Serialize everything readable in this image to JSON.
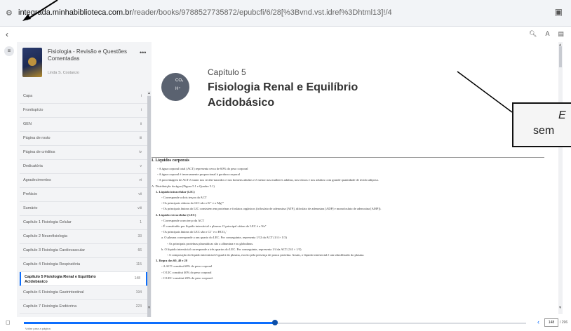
{
  "browser": {
    "url_host": "integrada.minhabiblioteca.com.br",
    "url_path": "/reader/books/9788527735872/epubcfi/6/28[%3Bvnd.vst.idref%3Dhtml13]!/4"
  },
  "book": {
    "title": "Fisiologia - Revisão e Questões Comentadas",
    "author": "Linda S. Costanzo"
  },
  "toc": [
    {
      "label": "Capa",
      "page": "i"
    },
    {
      "label": "Frontispício",
      "page": "i"
    },
    {
      "label": "GEN",
      "page": "ii"
    },
    {
      "label": "Página de rosto",
      "page": "iii"
    },
    {
      "label": "Página de créditos",
      "page": "iv"
    },
    {
      "label": "Dedicatória",
      "page": "v"
    },
    {
      "label": "Agradecimentos",
      "page": "vi"
    },
    {
      "label": "Prefácio",
      "page": "vii"
    },
    {
      "label": "Sumário",
      "page": "viii"
    },
    {
      "label": "Capítulo 1 Fisiologia Celular",
      "page": "1"
    },
    {
      "label": "Capítulo 2 Neurofisiologia",
      "page": "33"
    },
    {
      "label": "Capítulo 3 Fisiologia Cardiovascular",
      "page": "66"
    },
    {
      "label": "Capítulo 4 Fisiologia Respiratória",
      "page": "115"
    },
    {
      "label": "Capítulo 5 Fisiologia Renal e Equilíbrio Acidobásico",
      "page": "148",
      "active": true
    },
    {
      "label": "Capítulo 6 Fisiologia Gastrintestinal",
      "page": "194"
    },
    {
      "label": "Capítulo 7 Fisiologia Endócrina",
      "page": "223"
    }
  ],
  "chapter": {
    "label": "Capítulo 5",
    "title": "Fisiologia Renal e Equilíbrio Acidobásico",
    "icon_text_1": "CO₂",
    "icon_text_2": "H⁺"
  },
  "content": {
    "section_title": "I. Líquidos corporais",
    "lines": [
      {
        "text": "◦  A água corporal total (ACT) representa cerca de 60% do peso corporal",
        "bold": false
      },
      {
        "text": "◦  A água corporal é inversamente proporcional à gordura corporal",
        "bold": false
      },
      {
        "text": "◦  A porcentagem de ACT é maior nos recém-nascidos e nos homens adultos e é menor nas mulheres adultas, nos idosos e nos adultos com grande quantidade de tecido adiposo.",
        "bold": false
      },
      {
        "text": "A.  Distribuição da água (Figura 5.1 e Quadro 5.1)",
        "bold": false
      },
      {
        "text": "1.  Líquido intracelular (LIC)",
        "bold": true
      },
      {
        "text": "◦  Corresponde a dois terços da ACT",
        "bold": false
      },
      {
        "text": "◦  Os principais cátions do LIC são o K⁺ e o Mg²⁺",
        "bold": false
      },
      {
        "text": "◦  Os principais ânions do LIC consistem em proteínas e fosfatos orgânicos (trifosfato de adenosina [ATP], difosfato de adenosina [ADP] e monofosfato de adenosina [AMP]).",
        "bold": false
      },
      {
        "text": "2.  Líquido extracelular (LEC)",
        "bold": true
      },
      {
        "text": "◦  Corresponde a um terço da ACT",
        "bold": false
      },
      {
        "text": "◦  É constituído por líquido intersticial e plasma. O principal cátion do LEC é o Na⁺",
        "bold": false
      },
      {
        "text": "◦  Os principais ânions do LEC são o Cl⁻ e o HCO₃⁻",
        "bold": false
      },
      {
        "text": "a.  O plasma corresponde a um quarto do LEC. Por conseguinte, representa 1/12 da ACT (1/4 × 1/3)",
        "bold": false
      },
      {
        "text": "◦  As principais proteínas plasmáticas são a albumina e as globulinas.",
        "bold": false
      },
      {
        "text": "b.  O líquido intersticial corresponde a três quartos do LEC. Por conseguinte, representa 1/4 da ACT (3/4 × 1/3)",
        "bold": false
      },
      {
        "text": "◦  A composição do líquido intersticial é igual à do plasma, exceto pela presença de pouca proteína. Assim, o líquido intersticial é um ultrafiltrado do plasma.",
        "bold": false
      },
      {
        "text": "3.  Regra dos 60, 40 e 20",
        "bold": true
      },
      {
        "text": "◦  A ACT constitui 60% do peso corporal",
        "bold": false
      },
      {
        "text": "◦  O LIC constitui 40% do peso corporal",
        "bold": false
      },
      {
        "text": "◦  O LEC constitui 20% do peso corporal.",
        "bold": false
      }
    ]
  },
  "bottom": {
    "back_link": "Voltar para a página",
    "current_page": "148",
    "total_pages": "/ 296",
    "progress": 0.5
  },
  "callout": {
    "line1": "E",
    "line2": "sem"
  }
}
